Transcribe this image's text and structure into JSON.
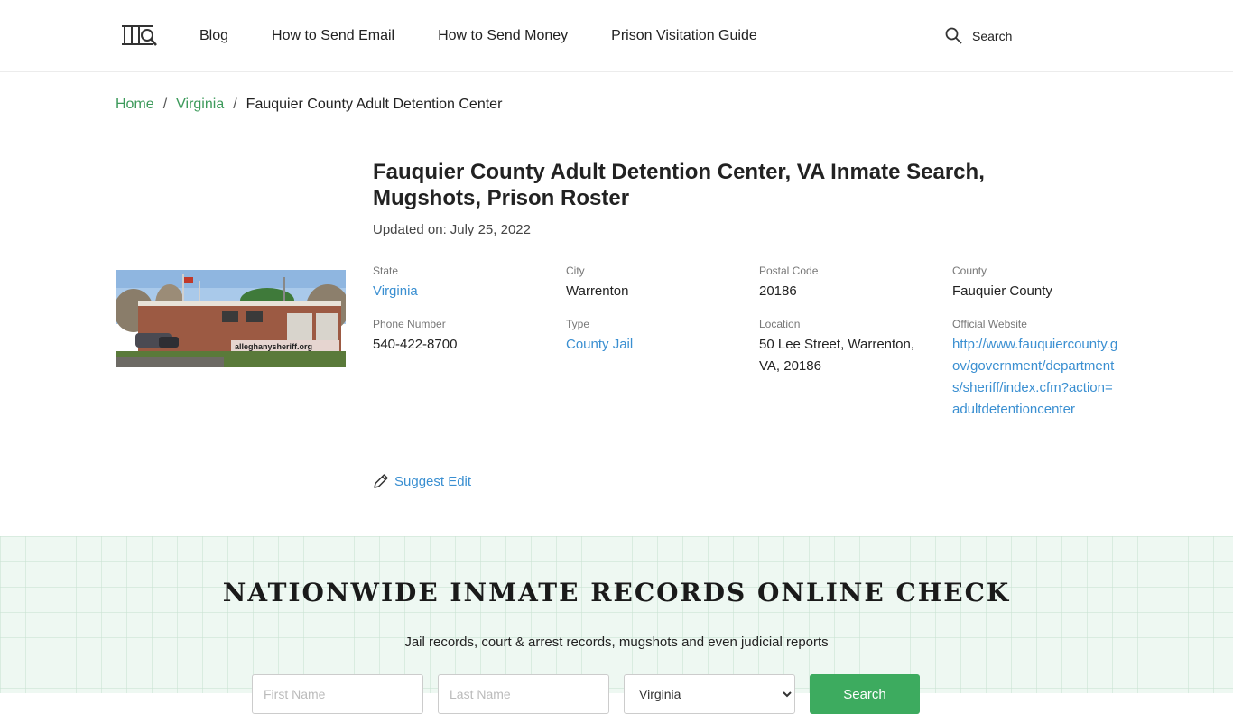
{
  "nav": {
    "items": [
      {
        "label": "Blog"
      },
      {
        "label": "How to Send Email"
      },
      {
        "label": "How to Send Money"
      },
      {
        "label": "Prison Visitation Guide"
      }
    ],
    "search_label": "Search"
  },
  "breadcrumb": {
    "home": "Home",
    "state": "Virginia",
    "current": "Fauquier County Adult Detention Center",
    "separator": "/"
  },
  "facility": {
    "title": "Fauquier County Adult Detention Center, VA Inmate Search, Mugshots, Prison Roster",
    "updated_label": "Updated on:",
    "updated_date": "July 25, 2022",
    "photo_watermark": "alleghanysheriff.org",
    "fields": {
      "state": {
        "label": "State",
        "value": "Virginia"
      },
      "city": {
        "label": "City",
        "value": "Warrenton"
      },
      "postal": {
        "label": "Postal Code",
        "value": "20186"
      },
      "county": {
        "label": "County",
        "value": "Fauquier County"
      },
      "phone": {
        "label": "Phone Number",
        "value": "540-422-8700"
      },
      "type": {
        "label": "Type",
        "value": "County Jail"
      },
      "location": {
        "label": "Location",
        "value": "50 Lee Street, Warrenton, VA, 20186"
      },
      "website": {
        "label": "Official Website",
        "value": "http://www.fauquiercounty.gov/government/departments/sheriff/index.cfm?action=adultdetentioncenter"
      }
    },
    "suggest_edit": "Suggest Edit"
  },
  "records": {
    "title": "NATIONWIDE INMATE RECORDS ONLINE CHECK",
    "subtitle": "Jail records, court & arrest records, mugshots and even judicial reports",
    "first_name_placeholder": "First Name",
    "last_name_placeholder": "Last Name",
    "state_selected": "Virginia",
    "search_button": "Search"
  },
  "colors": {
    "green_link": "#3d9a5b",
    "blue_link": "#3a8fd1",
    "search_button": "#3dab5f",
    "band_background": "#eef8f2"
  }
}
